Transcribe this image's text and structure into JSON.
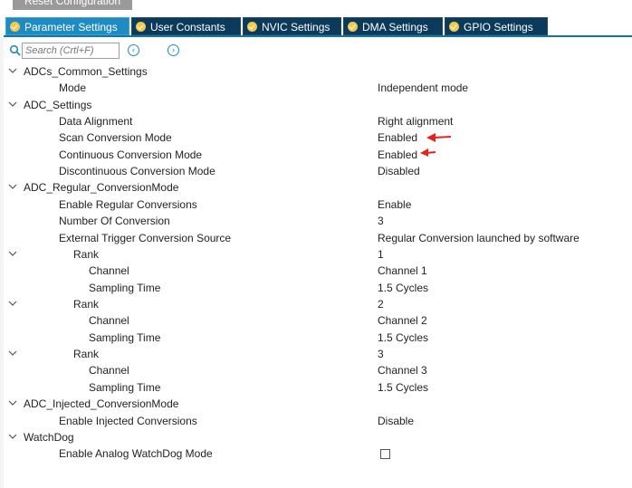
{
  "top_button": {
    "label": "Reset Configuration"
  },
  "tabs": [
    {
      "label": "Parameter Settings",
      "active": true
    },
    {
      "label": "User Constants",
      "active": false
    },
    {
      "label": "NVIC Settings",
      "active": false
    },
    {
      "label": "DMA Settings",
      "active": false
    },
    {
      "label": "GPIO Settings",
      "active": false
    }
  ],
  "search": {
    "placeholder": "Search (Crtl+F)"
  },
  "tree": {
    "groups": {
      "common": {
        "label": "ADCs_Common_Settings"
      },
      "adc": {
        "label": "ADC_Settings"
      },
      "regular": {
        "label": "ADC_Regular_ConversionMode"
      },
      "injected": {
        "label": "ADC_Injected_ConversionMode"
      },
      "watchdog": {
        "label": "WatchDog"
      }
    },
    "mode": {
      "label": "Mode",
      "value": "Independent mode"
    },
    "data_alignment": {
      "label": "Data Alignment",
      "value": "Right alignment"
    },
    "scan_mode": {
      "label": "Scan Conversion Mode",
      "value": "Enabled"
    },
    "continuous_mode": {
      "label": "Continuous Conversion Mode",
      "value": "Enabled"
    },
    "discontinuous_mode": {
      "label": "Discontinuous Conversion Mode",
      "value": "Disabled"
    },
    "enable_regular": {
      "label": "Enable Regular Conversions",
      "value": "Enable"
    },
    "num_conversion": {
      "label": "Number Of Conversion",
      "value": "3"
    },
    "ext_trigger": {
      "label": "External Trigger Conversion Source",
      "value": "Regular Conversion launched by software"
    },
    "ranks": [
      {
        "label": "Rank",
        "value": "1",
        "channel_label": "Channel",
        "channel": "Channel 1",
        "sampling_label": "Sampling Time",
        "sampling": "1.5 Cycles"
      },
      {
        "label": "Rank",
        "value": "2",
        "channel_label": "Channel",
        "channel": "Channel 2",
        "sampling_label": "Sampling Time",
        "sampling": "1.5 Cycles"
      },
      {
        "label": "Rank",
        "value": "3",
        "channel_label": "Channel",
        "channel": "Channel 3",
        "sampling_label": "Sampling Time",
        "sampling": "1.5 Cycles"
      }
    ],
    "enable_injected": {
      "label": "Enable Injected Conversions",
      "value": "Disable"
    },
    "analog_watchdog": {
      "label": "Enable Analog WatchDog Mode",
      "checked": false
    }
  },
  "colors": {
    "tab_bg": "#0b3a5b",
    "tab_active": "#1e8bc3",
    "annotation_arrow": "#e8211c"
  }
}
